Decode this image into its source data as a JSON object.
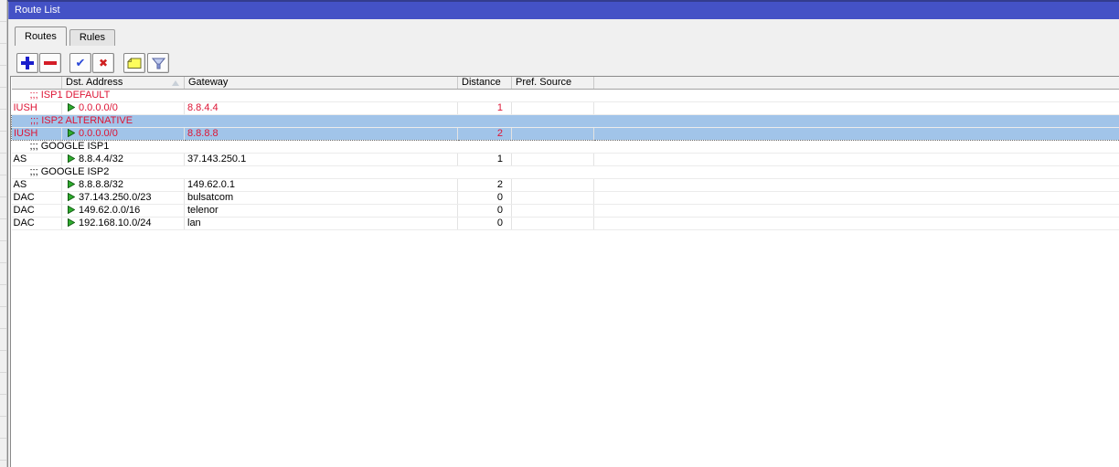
{
  "window": {
    "title": "Route List"
  },
  "tabs": [
    {
      "label": "Routes",
      "active": true
    },
    {
      "label": "Rules",
      "active": false
    }
  ],
  "toolbar": {
    "buttons": [
      {
        "icon": "plus-icon",
        "action": "add"
      },
      {
        "icon": "minus-icon",
        "action": "remove"
      },
      {
        "icon": "check-icon",
        "action": "enable"
      },
      {
        "icon": "cross-icon",
        "action": "disable"
      },
      {
        "icon": "comment-icon",
        "action": "comment"
      },
      {
        "icon": "filter-icon",
        "action": "filter"
      }
    ]
  },
  "table": {
    "columns": [
      "",
      "Dst. Address",
      "Gateway",
      "Distance",
      "Pref. Source"
    ],
    "sorted_by": "Dst. Address",
    "sort_direction": "asc",
    "rows": [
      {
        "type": "comment",
        "text": ";;; ISP1 DEFAULT",
        "text_color": "red",
        "selected": false
      },
      {
        "type": "route",
        "flags": "IUSH",
        "dst": "0.0.0.0/0",
        "gateway": "8.8.4.4",
        "distance": "1",
        "pref_source": "",
        "text_color": "red",
        "selected": false
      },
      {
        "type": "comment",
        "text": ";;; ISP2 ALTERNATIVE",
        "text_color": "red",
        "selected": true
      },
      {
        "type": "route",
        "flags": "IUSH",
        "dst": "0.0.0.0/0",
        "gateway": "8.8.8.8",
        "distance": "2",
        "pref_source": "",
        "text_color": "red",
        "selected": true
      },
      {
        "type": "comment",
        "text": ";;; GOOGLE ISP1",
        "text_color": "default",
        "selected": false
      },
      {
        "type": "route",
        "flags": "AS",
        "dst": "8.8.4.4/32",
        "gateway": "37.143.250.1",
        "distance": "1",
        "pref_source": "",
        "text_color": "default",
        "selected": false
      },
      {
        "type": "comment",
        "text": ";;; GOOGLE ISP2",
        "text_color": "default",
        "selected": false
      },
      {
        "type": "route",
        "flags": "AS",
        "dst": "8.8.8.8/32",
        "gateway": "149.62.0.1",
        "distance": "2",
        "pref_source": "",
        "text_color": "default",
        "selected": false
      },
      {
        "type": "route",
        "flags": "DAC",
        "dst": "37.143.250.0/23",
        "gateway": "bulsatcom",
        "distance": "0",
        "pref_source": "",
        "text_color": "default",
        "selected": false
      },
      {
        "type": "route",
        "flags": "DAC",
        "dst": "149.62.0.0/16",
        "gateway": "telenor",
        "distance": "0",
        "pref_source": "",
        "text_color": "default",
        "selected": false
      },
      {
        "type": "route",
        "flags": "DAC",
        "dst": "192.168.10.0/24",
        "gateway": "lan",
        "distance": "0",
        "pref_source": "",
        "text_color": "default",
        "selected": false
      }
    ]
  },
  "colors": {
    "titlebar": "#4452c6",
    "selection": "#a1c4e9",
    "inactive_route_text": "#dd1535",
    "active_route_arrow": "#2fae2f"
  }
}
